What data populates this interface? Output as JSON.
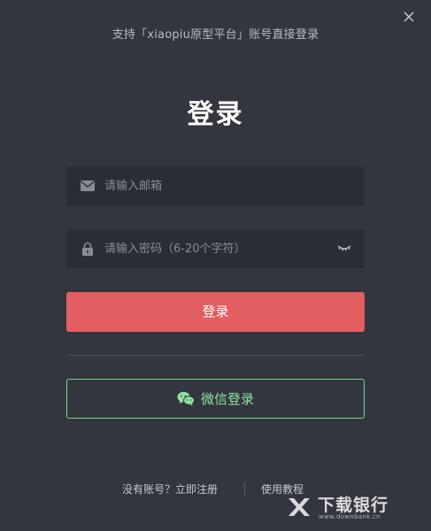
{
  "header": {
    "subtitle": "支持「xiaopiu原型平台」账号直接登录",
    "close_icon": "close-icon"
  },
  "title": "登录",
  "form": {
    "email": {
      "icon": "envelope-icon",
      "placeholder": "请输入邮箱",
      "value": ""
    },
    "password": {
      "icon": "lock-icon",
      "placeholder": "请输入密码（6-20个字符）",
      "value": "",
      "toggle_icon": "eye-closed-icon"
    },
    "login_label": "登录"
  },
  "wechat": {
    "icon": "wechat-icon",
    "label": "微信登录"
  },
  "footer": {
    "register_label": "没有账号？立即注册",
    "tutorial_label": "使用教程"
  },
  "watermark": {
    "name": "下载银行",
    "url": "www.downbank.cn"
  },
  "colors": {
    "background": "#33353f",
    "field_background": "#2b2d36",
    "primary": "#e35e60",
    "wechat_green": "#7bd58f"
  }
}
